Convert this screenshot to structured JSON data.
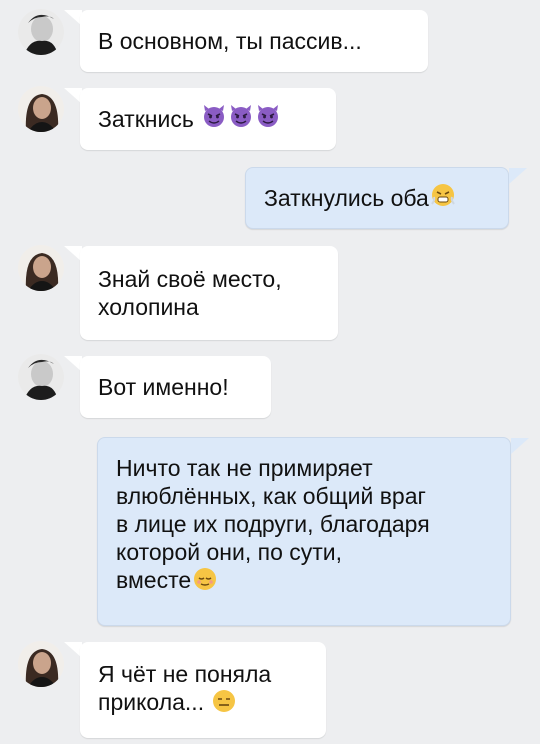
{
  "messages": [
    {
      "text": "В основном, ты пассив..."
    },
    {
      "text": "Заткнись",
      "emoji": [
        "devil-face",
        "devil-face",
        "devil-face"
      ]
    },
    {
      "text": "Заткнулись оба",
      "emoji": [
        "steam-face"
      ]
    },
    {
      "text": "Знай своё место,\nхолопина"
    },
    {
      "text": "Вот именно!"
    },
    {
      "text": "Ничто так не примиряет\nвлюблённых, как общий враг\nв лице их подруги, благодаря\nкоторой они, по сути,\nвместе",
      "emoji": [
        "relieved-face"
      ]
    },
    {
      "text": "Я чёт не поняла\nприкола... ",
      "emoji": [
        "expressionless-face"
      ]
    }
  ],
  "colors": {
    "background": "#edeef0",
    "incoming": "#ffffff",
    "outgoing": "#dce9f9",
    "emoji_purple": "#8a5cc4",
    "emoji_yellow": "#f6c544"
  }
}
